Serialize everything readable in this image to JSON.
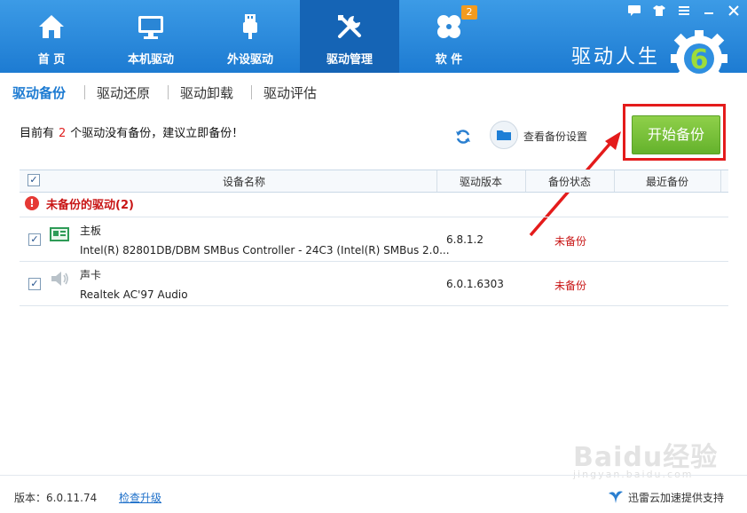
{
  "nav": {
    "items": [
      {
        "label": "首 页",
        "icon": "home-icon"
      },
      {
        "label": "本机驱动",
        "icon": "monitor-icon"
      },
      {
        "label": "外设驱动",
        "icon": "usb-icon"
      },
      {
        "label": "驱动管理",
        "icon": "tools-icon"
      },
      {
        "label": "软 件",
        "icon": "apps-icon"
      }
    ],
    "active": "驱动管理",
    "software_badge": "2"
  },
  "brand": {
    "name": "驱动人生",
    "logo_digit": "6"
  },
  "window_controls": [
    "message-icon",
    "skin-icon",
    "menu-icon",
    "minimize-icon",
    "close-icon"
  ],
  "subtabs": {
    "items": [
      "驱动备份",
      "驱动还原",
      "驱动卸载",
      "驱动评估"
    ],
    "active": "驱动备份"
  },
  "notice": {
    "prefix": "目前有",
    "count": "2",
    "suffix": "个驱动没有备份，建议立即备份！"
  },
  "toolbar": {
    "view_settings": "查看备份设置",
    "start_backup": "开始备份"
  },
  "table": {
    "columns": [
      "设备名称",
      "驱动版本",
      "备份状态",
      "最近备份"
    ],
    "group_label": "未备份的驱动(2)",
    "rows": [
      {
        "name": "主板",
        "desc": "Intel(R) 82801DB/DBM SMBus Controller - 24C3 (Intel(R) SMBus 2.0...",
        "version": "6.8.1.2",
        "status": "未备份",
        "last": "",
        "icon": "motherboard-icon"
      },
      {
        "name": "声卡",
        "desc": "Realtek AC'97 Audio",
        "version": "6.0.1.6303",
        "status": "未备份",
        "last": "",
        "icon": "speaker-icon"
      }
    ]
  },
  "footer": {
    "version": "版本：6.0.11.74",
    "check_update": "检查升级",
    "support": "迅雷云加速提供支持"
  },
  "watermark": {
    "text": "Baidu经验",
    "sub": "jingyan.baidu.com"
  },
  "colors": {
    "topbar": "#2588dc",
    "active_nav": "#1564b5",
    "accent_blue": "#1d7bd2",
    "start_green": "#75be34",
    "warning_red": "#c81414",
    "highlight_red": "#e41b1b"
  }
}
